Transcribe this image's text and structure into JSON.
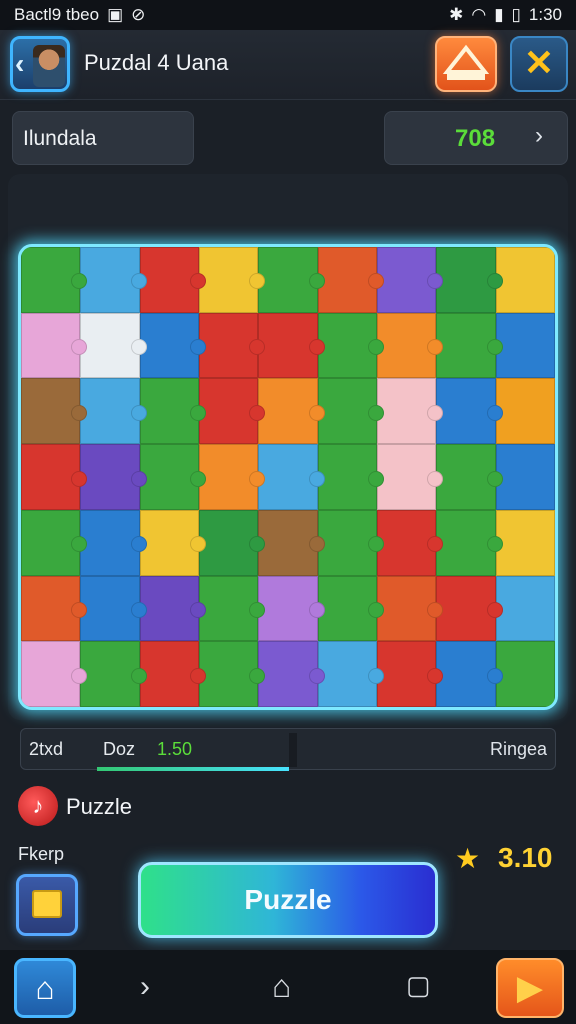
{
  "status_bar": {
    "left_text": "Bactl9 tbeo",
    "time": "1:30"
  },
  "header": {
    "title": "Puzdal 4 Uana"
  },
  "info": {
    "left_label": "Ilundala",
    "score": "708"
  },
  "progress": {
    "label_a": "2txd",
    "label_b": "Doz",
    "value": "1.50",
    "right_label": "Ringea",
    "fill_fraction": 1.0
  },
  "bottom": {
    "puzzle_label": "Puzzle",
    "small_label": "Fkerp",
    "rating": "3.10",
    "main_button": "Puzzle"
  },
  "board": {
    "rows": 7,
    "cols": 9,
    "piece_colors": [
      "#3aa83e",
      "#49a9e0",
      "#d7362e",
      "#f0c532",
      "#3aa83e",
      "#e05a2a",
      "#7b5ad0",
      "#2e9a42",
      "#f0c532",
      "#e7a6d8",
      "#e9eef2",
      "#2a7ed0",
      "#d7362e",
      "#d7362e",
      "#3aa83e",
      "#f28c2a",
      "#3aa83e",
      "#2a7ed0",
      "#9a6a3a",
      "#49a9e0",
      "#3aa83e",
      "#d7362e",
      "#f28c2a",
      "#3aa83e",
      "#f4c2c8",
      "#2a7ed0",
      "#f0a020",
      "#d7362e",
      "#6a4ac0",
      "#3aa83e",
      "#f28c2a",
      "#49a9e0",
      "#3aa83e",
      "#f4c2c8",
      "#3aa83e",
      "#2a7ed0",
      "#3aa83e",
      "#2a7ed0",
      "#f0c532",
      "#2e9a42",
      "#9a6a3a",
      "#3aa83e",
      "#d7362e",
      "#3aa83e",
      "#f0c532",
      "#e05a2a",
      "#2a7ed0",
      "#6a4ac0",
      "#3aa83e",
      "#b07adc",
      "#3aa83e",
      "#e05a2a",
      "#d7362e",
      "#49a9e0",
      "#e7a6d8",
      "#3aa83e",
      "#d7362e",
      "#3aa83e",
      "#7b5ad0",
      "#49a9e0",
      "#d7362e",
      "#2a7ed0",
      "#3aa83e"
    ]
  }
}
